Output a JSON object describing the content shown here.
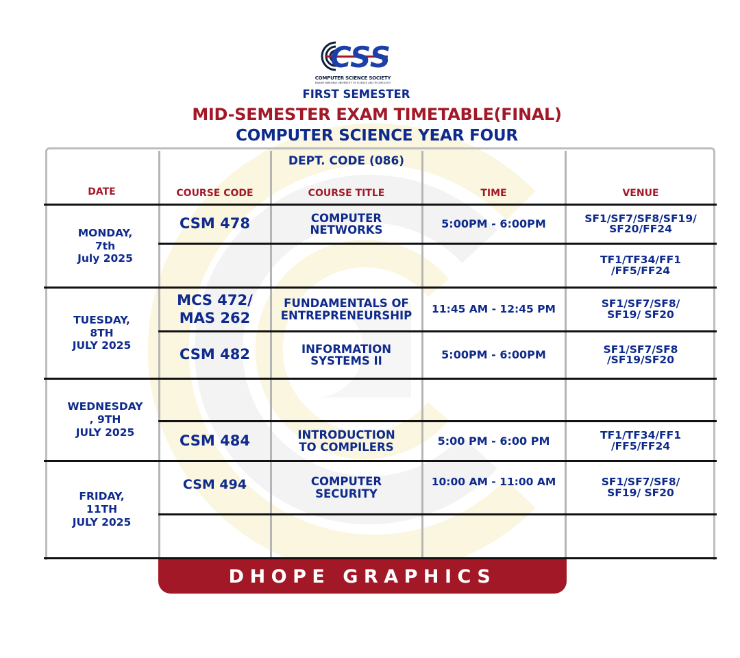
{
  "colors": {
    "navy": "#0e2a8c",
    "maroon": "#a31826",
    "grid": "#b5b5b5",
    "rule": "#111111"
  },
  "logo": {
    "word": "CSS",
    "name": "COMPUTER SCIENCE SOCIETY",
    "subtitle": "KWAME NKRUMAH UNIVERSITY OF SCIENCE AND TECHNOLOGY"
  },
  "heading": {
    "semester": "FIRST SEMESTER",
    "title": "MID-SEMESTER EXAM TIMETABLE(FINAL)",
    "program": "COMPUTER SCIENCE YEAR FOUR"
  },
  "table": {
    "dept_code": "DEPT. CODE (086)",
    "headers": {
      "date": "DATE",
      "course_code": "COURSE CODE",
      "course_title": "COURSE TITLE",
      "time": "TIME",
      "venue": "VENUE"
    },
    "dates": [
      {
        "label": "MONDAY,\n7th\nJuly 2025"
      },
      {
        "label": "TUESDAY,\n8TH\nJULY 2025"
      },
      {
        "label": "WEDNESDAY\n,  9TH\nJULY 2025"
      },
      {
        "label": "FRIDAY,\n11TH\nJULY 2025"
      }
    ],
    "rows": [
      {
        "code": "CSM 478",
        "title": "COMPUTER\nNETWORKS",
        "time": "5:00PM - 6:00PM",
        "venue": "SF1/SF7/SF8/SF19/\nSF20/FF24"
      },
      {
        "code": "",
        "title": "",
        "time": "",
        "venue": "TF1/TF34/FF1\n/FF5/FF24"
      },
      {
        "code": "MCS 472/\nMAS 262",
        "title": "FUNDAMENTALS OF\nENTREPRENEURSHIP",
        "time": "11:45 AM - 12:45 PM",
        "venue": "SF1/SF7/SF8/\nSF19/ SF20"
      },
      {
        "code": "CSM 482",
        "title": "INFORMATION\nSYSTEMS II",
        "time": "5:00PM - 6:00PM",
        "venue": "SF1/SF7/SF8\n/SF19/SF20"
      },
      {
        "code": "",
        "title": "",
        "time": "",
        "venue": ""
      },
      {
        "code": "CSM 484",
        "title": "INTRODUCTION\nTO COMPILERS",
        "time": "5:00 PM - 6:00 PM",
        "venue": "TF1/TF34/FF1\n/FF5/FF24"
      },
      {
        "code": "CSM 494",
        "title": "COMPUTER\nSECURITY",
        "time": "10:00 AM - 11:00 AM",
        "venue": "SF1/SF7/SF8/\nSF19/ SF20"
      },
      {
        "code": "",
        "title": "",
        "time": "",
        "venue": ""
      }
    ]
  },
  "banner": "DHOPE GRAPHICS"
}
